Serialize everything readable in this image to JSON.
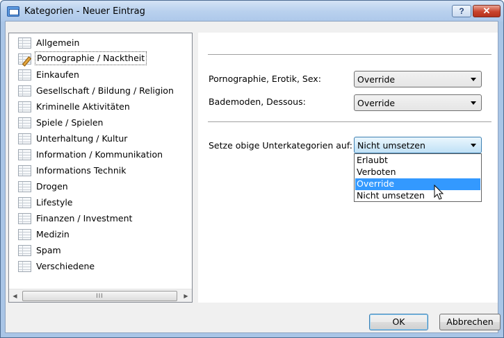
{
  "window": {
    "title": "Kategorien - Neuer Eintrag",
    "help_label": "?",
    "close_label": "✕"
  },
  "tree": {
    "items": [
      {
        "label": "Allgemein",
        "icon": "list-icon"
      },
      {
        "label": "Pornographie / Nacktheit",
        "icon": "edit-list-icon",
        "selected": true
      },
      {
        "label": "Einkaufen",
        "icon": "list-icon"
      },
      {
        "label": "Gesellschaft / Bildung / Religion",
        "icon": "list-icon"
      },
      {
        "label": "Kriminelle Aktivitäten",
        "icon": "list-icon"
      },
      {
        "label": "Spiele / Spielen",
        "icon": "list-icon"
      },
      {
        "label": "Unterhaltung / Kultur",
        "icon": "list-icon"
      },
      {
        "label": "Information / Kommunikation",
        "icon": "list-icon"
      },
      {
        "label": "Informations Technik",
        "icon": "list-icon"
      },
      {
        "label": "Drogen",
        "icon": "list-icon"
      },
      {
        "label": "Lifestyle",
        "icon": "list-icon"
      },
      {
        "label": "Finanzen / Investment",
        "icon": "list-icon"
      },
      {
        "label": "Medizin",
        "icon": "list-icon"
      },
      {
        "label": "Spam",
        "icon": "list-icon"
      },
      {
        "label": "Verschiedene",
        "icon": "list-icon"
      }
    ],
    "scroll_left": "◀",
    "scroll_right": "▶",
    "scroll_grip": "III"
  },
  "fields": {
    "porn_label": "Pornographie, Erotik, Sex:",
    "porn_value": "Override",
    "bademoden_label": "Bademoden, Dessous:",
    "bademoden_value": "Override",
    "setze_label": "Setze obige Unterkategorien auf:",
    "setze_value": "Nicht umsetzen"
  },
  "dropdown": {
    "options": [
      "Erlaubt",
      "Verboten",
      "Override",
      "Nicht umsetzen"
    ],
    "highlighted": "Override"
  },
  "buttons": {
    "ok": "OK",
    "cancel": "Abbrechen"
  },
  "colors": {
    "highlight": "#3399ff",
    "close_button": "#c9432c",
    "title_bar": "#b9d1ee"
  }
}
